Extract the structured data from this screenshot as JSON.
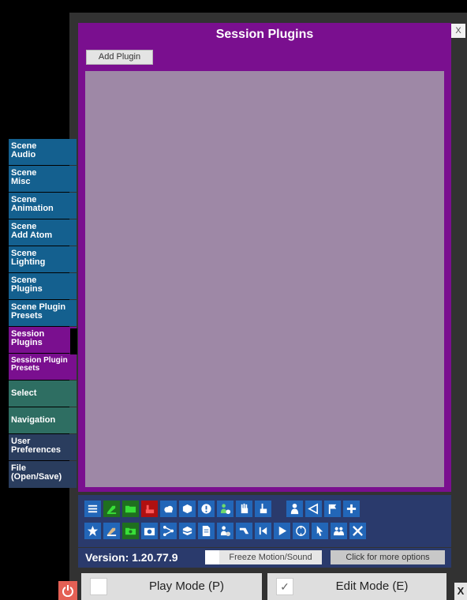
{
  "panel": {
    "title": "Session Plugins",
    "add_plugin_label": "Add Plugin",
    "close_label": "X"
  },
  "tabs": [
    {
      "label": "Scene\nAudio"
    },
    {
      "label": "Scene\nMisc"
    },
    {
      "label": "Scene\nAnimation"
    },
    {
      "label": "Scene\nAdd Atom"
    },
    {
      "label": "Scene\nLighting"
    },
    {
      "label": "Scene\nPlugins"
    },
    {
      "label": "Scene Plugin\nPresets"
    },
    {
      "label": "Session\nPlugins"
    },
    {
      "label": "Session Plugin\nPresets"
    },
    {
      "label": "Select"
    },
    {
      "label": "Navigation"
    },
    {
      "label": "User\nPreferences"
    },
    {
      "label": "File\n(Open/Save)"
    }
  ],
  "active_tab": "Session\nPlugins",
  "toolbar": {
    "row1": [
      "menu-icon",
      "scene-edit-icon",
      "folder-icon",
      "hand-red-icon",
      "cloud-icon",
      "package-icon",
      "alert-icon",
      "person-add-icon",
      "hand-grab-icon",
      "pointer-hand-icon",
      "person-icon",
      "unity-icon",
      "flag-icon",
      "plus-icon"
    ],
    "row2": [
      "star-icon",
      "scene-load-icon",
      "folder-gear-icon",
      "camera-icon",
      "nodes-icon",
      "package-open-icon",
      "document-icon",
      "person-remove-icon",
      "pose-icon",
      "skip-back-icon",
      "play-icon",
      "target-icon",
      "cursor-icon",
      "people-icon",
      "tools-icon"
    ]
  },
  "status": {
    "version": "Version: 1.20.77.9",
    "freeze_label": "Freeze Motion/Sound",
    "more_options_label": "Click for more options"
  },
  "modes": {
    "play_label": "Play Mode (P)",
    "edit_label": "Edit Mode (E)",
    "edit_check": "✓",
    "close_label": "X"
  },
  "colors": {
    "panel_purple": "#7a0f8f",
    "plugin_area": "#9e88a6",
    "tab_blue": "#14608f",
    "tab_teal": "#2e6e62",
    "tab_navy": "#2a3d5e",
    "toolbar_bg": "#2a3a6c",
    "icon_blue": "#2266b8",
    "power_red": "#e46055"
  }
}
